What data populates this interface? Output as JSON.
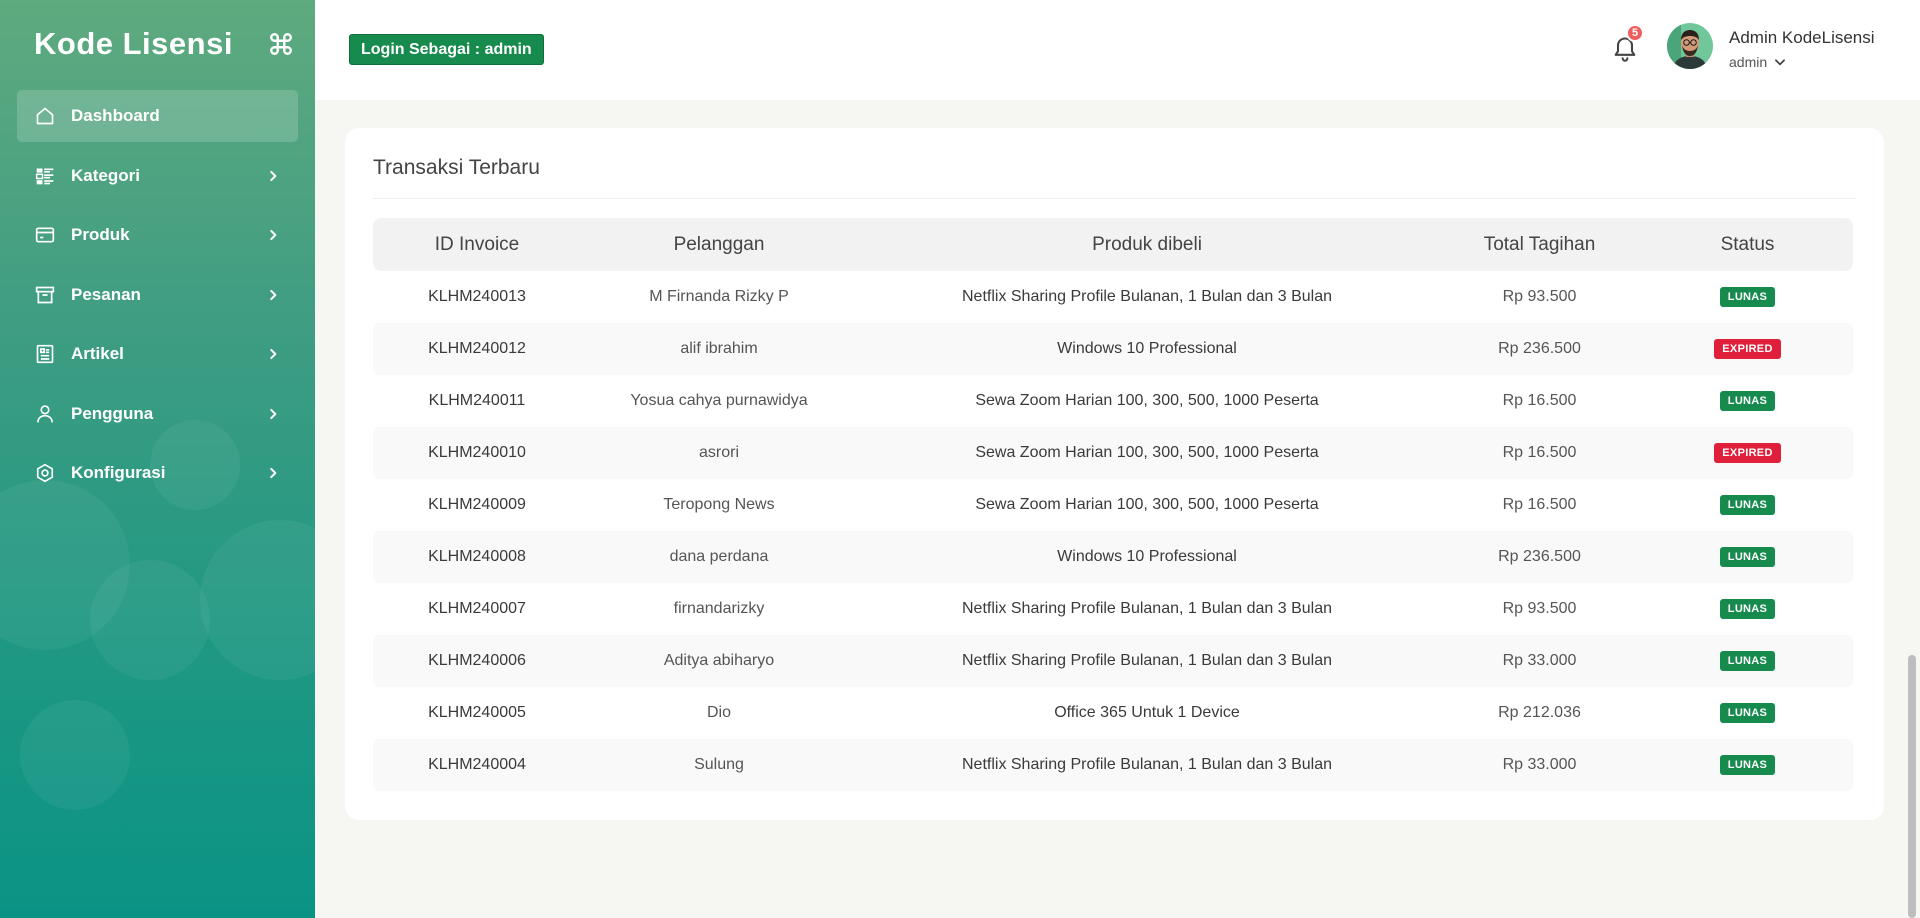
{
  "brand": {
    "title": "Kode Lisensi",
    "toggle_icon": "command-icon"
  },
  "sidebar": {
    "items": [
      {
        "label": "Dashboard",
        "icon": "home-icon",
        "active": true,
        "has_submenu": false
      },
      {
        "label": "Kategori",
        "icon": "category-icon",
        "active": false,
        "has_submenu": true
      },
      {
        "label": "Produk",
        "icon": "card-icon",
        "active": false,
        "has_submenu": true
      },
      {
        "label": "Pesanan",
        "icon": "archive-icon",
        "active": false,
        "has_submenu": true
      },
      {
        "label": "Artikel",
        "icon": "article-icon",
        "active": false,
        "has_submenu": true
      },
      {
        "label": "Pengguna",
        "icon": "user-icon",
        "active": false,
        "has_submenu": true
      },
      {
        "label": "Konfigurasi",
        "icon": "settings-icon",
        "active": false,
        "has_submenu": true
      }
    ]
  },
  "header": {
    "login_badge": "Login Sebagai : admin",
    "notification_count": "5",
    "user_name": "Admin KodeLisensi",
    "user_role": "admin"
  },
  "transactions": {
    "title": "Transaksi Terbaru",
    "columns": [
      "ID Invoice",
      "Pelanggan",
      "Produk dibeli",
      "Total Tagihan",
      "Status"
    ],
    "rows": [
      {
        "id": "KLHM240013",
        "customer": "M Firnanda Rizky P",
        "product": "Netflix Sharing Profile Bulanan, 1 Bulan dan 3 Bulan",
        "total": "Rp 93.500",
        "status": "LUNAS"
      },
      {
        "id": "KLHM240012",
        "customer": "alif ibrahim",
        "product": "Windows 10 Professional",
        "total": "Rp 236.500",
        "status": "EXPIRED"
      },
      {
        "id": "KLHM240011",
        "customer": "Yosua cahya purnawidya",
        "product": "Sewa Zoom Harian 100, 300, 500, 1000 Peserta",
        "total": "Rp 16.500",
        "status": "LUNAS"
      },
      {
        "id": "KLHM240010",
        "customer": "asrori",
        "product": "Sewa Zoom Harian 100, 300, 500, 1000 Peserta",
        "total": "Rp 16.500",
        "status": "EXPIRED"
      },
      {
        "id": "KLHM240009",
        "customer": "Teropong News",
        "product": "Sewa Zoom Harian 100, 300, 500, 1000 Peserta",
        "total": "Rp 16.500",
        "status": "LUNAS"
      },
      {
        "id": "KLHM240008",
        "customer": "dana perdana",
        "product": "Windows 10 Professional",
        "total": "Rp 236.500",
        "status": "LUNAS"
      },
      {
        "id": "KLHM240007",
        "customer": "firnandarizky",
        "product": "Netflix Sharing Profile Bulanan, 1 Bulan dan 3 Bulan",
        "total": "Rp 93.500",
        "status": "LUNAS"
      },
      {
        "id": "KLHM240006",
        "customer": "Aditya abiharyo",
        "product": "Netflix Sharing Profile Bulanan, 1 Bulan dan 3 Bulan",
        "total": "Rp 33.000",
        "status": "LUNAS"
      },
      {
        "id": "KLHM240005",
        "customer": "Dio",
        "product": "Office 365 Untuk 1 Device",
        "total": "Rp 212.036",
        "status": "LUNAS"
      },
      {
        "id": "KLHM240004",
        "customer": "Sulung",
        "product": "Netflix Sharing Profile Bulanan, 1 Bulan dan 3 Bulan",
        "total": "Rp 33.000",
        "status": "LUNAS"
      }
    ]
  },
  "colors": {
    "sidebar_top": "#5faa7f",
    "sidebar_bottom": "#0a9384",
    "success": "#178a4e",
    "danger": "#e0203a",
    "notification": "#f05d5d"
  }
}
